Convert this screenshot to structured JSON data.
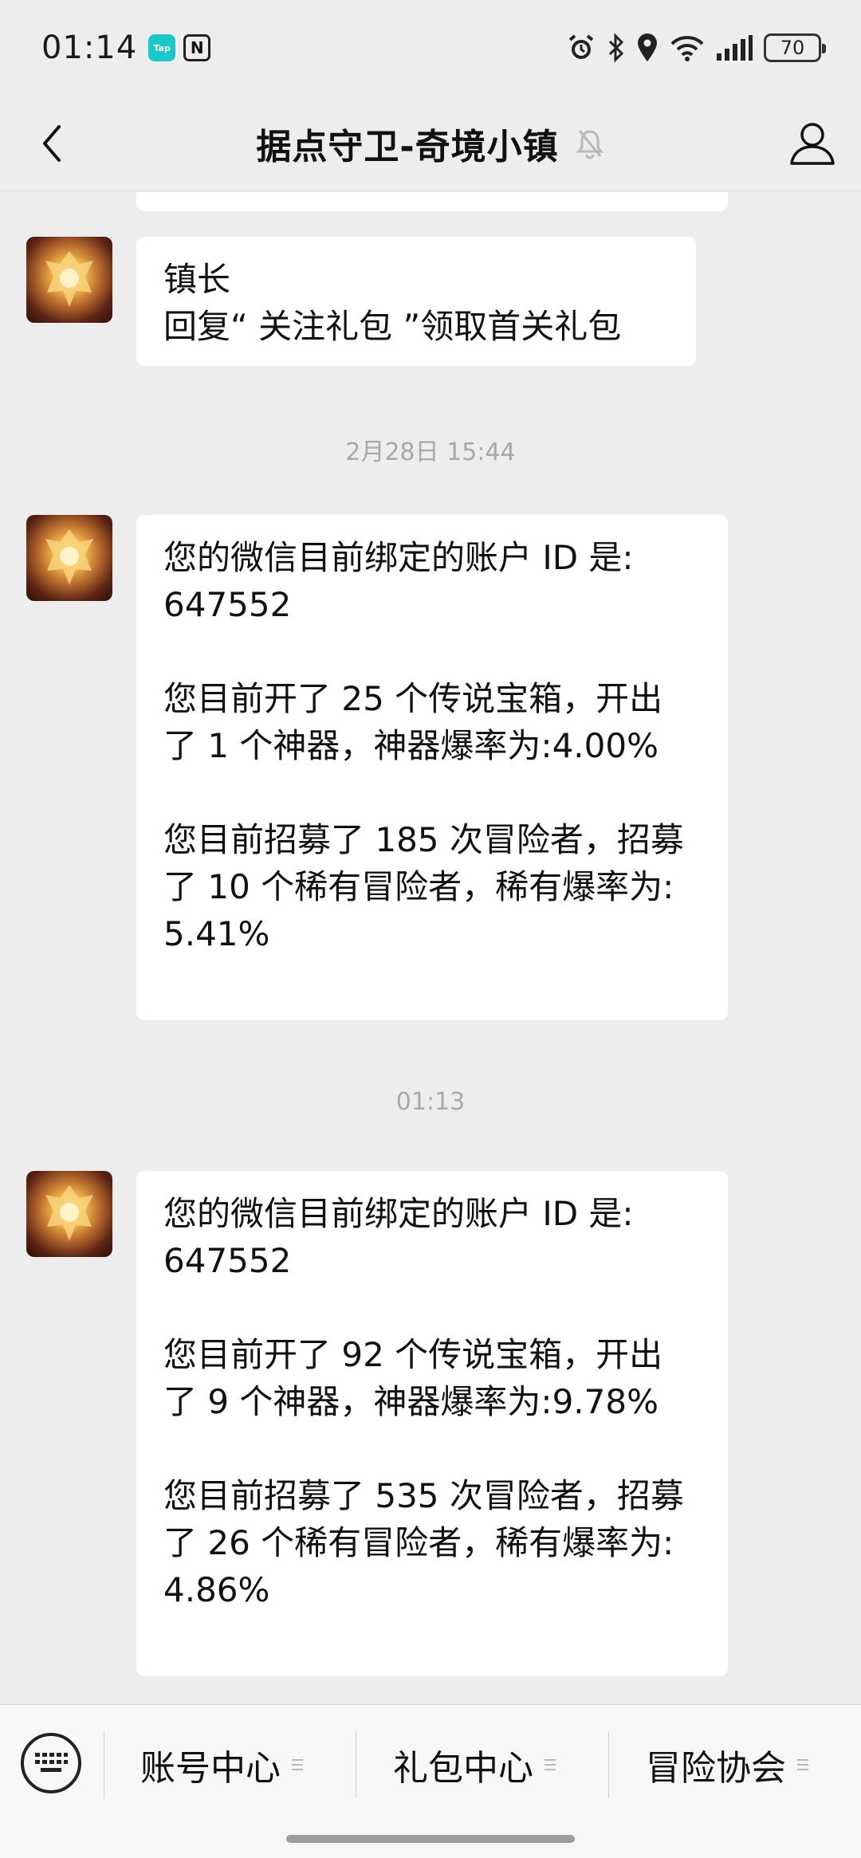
{
  "status_bar": {
    "time": "01:14",
    "tap_badge": "Tap",
    "nfc_glyph": "N",
    "battery": "70",
    "icons": [
      "alarm-icon",
      "bluetooth-icon",
      "location-icon",
      "wifi-icon",
      "signal-icon",
      "battery-icon"
    ]
  },
  "header": {
    "title": "据点守卫-奇境小镇",
    "icons": [
      "back-icon",
      "mute-icon",
      "profile-icon"
    ]
  },
  "messages": [
    {
      "type": "message",
      "lines": [
        "镇长",
        "回复“ 关注礼包 ”领取首关礼包"
      ]
    },
    {
      "type": "time",
      "text": "2月28日 15:44"
    },
    {
      "type": "message",
      "lines": [
        "您的微信目前绑定的账户 ID 是:",
        "647552",
        "",
        "您目前开了 25 个传说宝箱，开出",
        "了 1 个神器，神器爆率为:4.00%",
        "",
        "您目前招募了 185 次冒险者，招募",
        "了 10 个稀有冒险者，稀有爆率为:",
        "5.41%"
      ]
    },
    {
      "type": "time",
      "text": "01:13"
    },
    {
      "type": "message",
      "lines": [
        "您的微信目前绑定的账户 ID 是:",
        "647552",
        "",
        "您目前开了 92 个传说宝箱，开出",
        "了 9 个神器，神器爆率为:9.78%",
        "",
        "您目前招募了 535 次冒险者，招募",
        "了 26 个稀有冒险者，稀有爆率为:",
        "4.86%"
      ]
    }
  ],
  "bottom_menu": {
    "items": [
      "账号中心",
      "礼包中心",
      "冒险协会"
    ],
    "icons": [
      "keyboard-icon",
      "menu-lines-icon"
    ]
  }
}
